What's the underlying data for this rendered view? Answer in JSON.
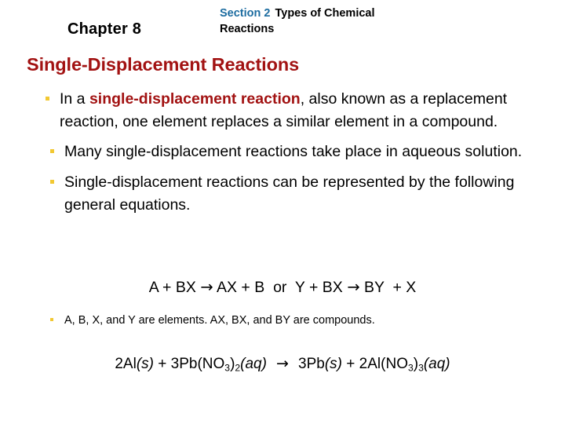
{
  "slide": {
    "background_color": "#FFFFFF",
    "header": {
      "chapter_label": "Chapter 8",
      "section_number": "Section 2",
      "section_title_line1": "Types of Chemical",
      "section_title_line2": "Reactions",
      "section_number_color": "#1C6CA0"
    },
    "title": {
      "text": "Single-Displacement Reactions",
      "color": "#A21212"
    },
    "bullet_marker_color": "#F2C832",
    "bullets": [
      {
        "id": "bullet-definition",
        "pre_text": "In a ",
        "keyword": "single-displacement reaction",
        "post_text": ", also known as a replacement reaction, one element replaces a similar element in a compound."
      },
      {
        "id": "bullet-aqueous",
        "text": "Many single-displacement reactions take place in aqueous solution."
      },
      {
        "id": "bullet-general-equations",
        "text": "Single-displacement reactions can be represented by the following general equations."
      }
    ],
    "general_equation": {
      "left_equation": "A + BX ",
      "left_arrow": "→",
      "left_products": " AX + B",
      "conjunction": "  or  ",
      "right_equation": "Y + BX ",
      "right_arrow": "→",
      "right_products": " BY  + X"
    },
    "elements_note": {
      "text": "A, B, X, and Y are elements. AX, BX, and BY are compounds."
    },
    "final_equation": {
      "reactant1_coefficient": "2",
      "reactant1_formula": "Al",
      "reactant1_state": "(s)",
      "plus1": " + ",
      "reactant2_coefficient": "3",
      "reactant2_formula_a": "Pb(NO",
      "reactant2_sub_a": "3",
      "reactant2_formula_b": ")",
      "reactant2_sub_b": "2",
      "reactant2_state": "(aq)",
      "arrow": "  →  ",
      "product1_coefficient": "3",
      "product1_formula": "Pb",
      "product1_state": "(s)",
      "plus2": " + ",
      "product2_coefficient": "2",
      "product2_formula_a": "Al(NO",
      "product2_sub_a": "3",
      "product2_formula_b": ")",
      "product2_sub_b": "3",
      "product2_state": "(aq)"
    }
  }
}
